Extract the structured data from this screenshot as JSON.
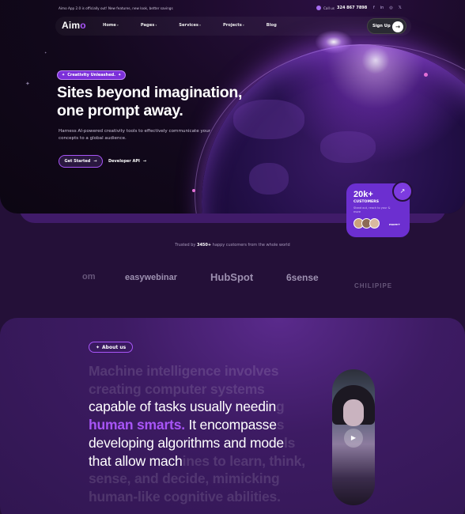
{
  "topbar": {
    "promo": "Aimo App 2.0 is officially out! New features, new look, better savings",
    "call_label": "Call us",
    "phone": "324 867 7898",
    "socials": [
      "f",
      "in",
      "◎",
      "𝕏"
    ]
  },
  "nav": {
    "logo": "Aim",
    "logo_accent": "o",
    "links": [
      "Home",
      "Pages",
      "Services",
      "Projects",
      "Blog"
    ],
    "signup": "Sign Up",
    "signup_arrow": "→"
  },
  "hero": {
    "badge": "Creativity Unleashed.",
    "badge_icon_left": "✦",
    "badge_icon_right": "✦",
    "title": "Sites beyond imagination, one prompt away.",
    "description": "Harness AI-powered creativity tools to effectively communicate your concepts to a global audience.",
    "primary_button": "Get Started",
    "secondary_button": "Developer API",
    "arrow": "→"
  },
  "customers_card": {
    "count": "20k+",
    "label": "CUSTOMERS",
    "sub": "Stand out, reach to your & more",
    "more": "more+",
    "arrow": "↗"
  },
  "trusted": {
    "prefix": "Trusted by",
    "count": "3450+",
    "suffix": "happy customers from the whole world"
  },
  "logos": [
    "om",
    "easywebinar",
    "HubSpot",
    "6sense",
    "CHILIPIPE"
  ],
  "about": {
    "badge": "About us",
    "badge_icon": "✦",
    "lines": [
      {
        "faded": "Machine intelligence involves",
        "bright": "",
        "accent": "",
        "bright2": "",
        "faded2": ""
      },
      {
        "faded": "creating computer systems",
        "bright": "",
        "accent": "",
        "bright2": "",
        "faded2": ""
      },
      {
        "faded": "",
        "bright": "capable of tasks usually needin",
        "accent": "",
        "bright2": "",
        "faded2": "g"
      },
      {
        "faded": "",
        "bright": "",
        "accent": "human smarts.",
        "bright2": " It encompasse",
        "faded2": "s"
      },
      {
        "faded": "",
        "bright": "developing algorithms and mode",
        "accent": "",
        "bright2": "",
        "faded2": "ls"
      },
      {
        "faded": "",
        "bright": "that allow mach",
        "accent": "",
        "bright2": "",
        "faded2": "ines to learn, think,"
      },
      {
        "faded": "sense, and decide, mimicking",
        "bright": "",
        "accent": "",
        "bright2": "",
        "faded2": ""
      },
      {
        "faded": "human-like cognitive abilities.",
        "bright": "",
        "accent": "",
        "bright2": "",
        "faded2": ""
      }
    ],
    "play_icon": "▶"
  },
  "colors": {
    "accent": "#a855f7",
    "card": "#6c2fd0",
    "background": "#241038"
  }
}
